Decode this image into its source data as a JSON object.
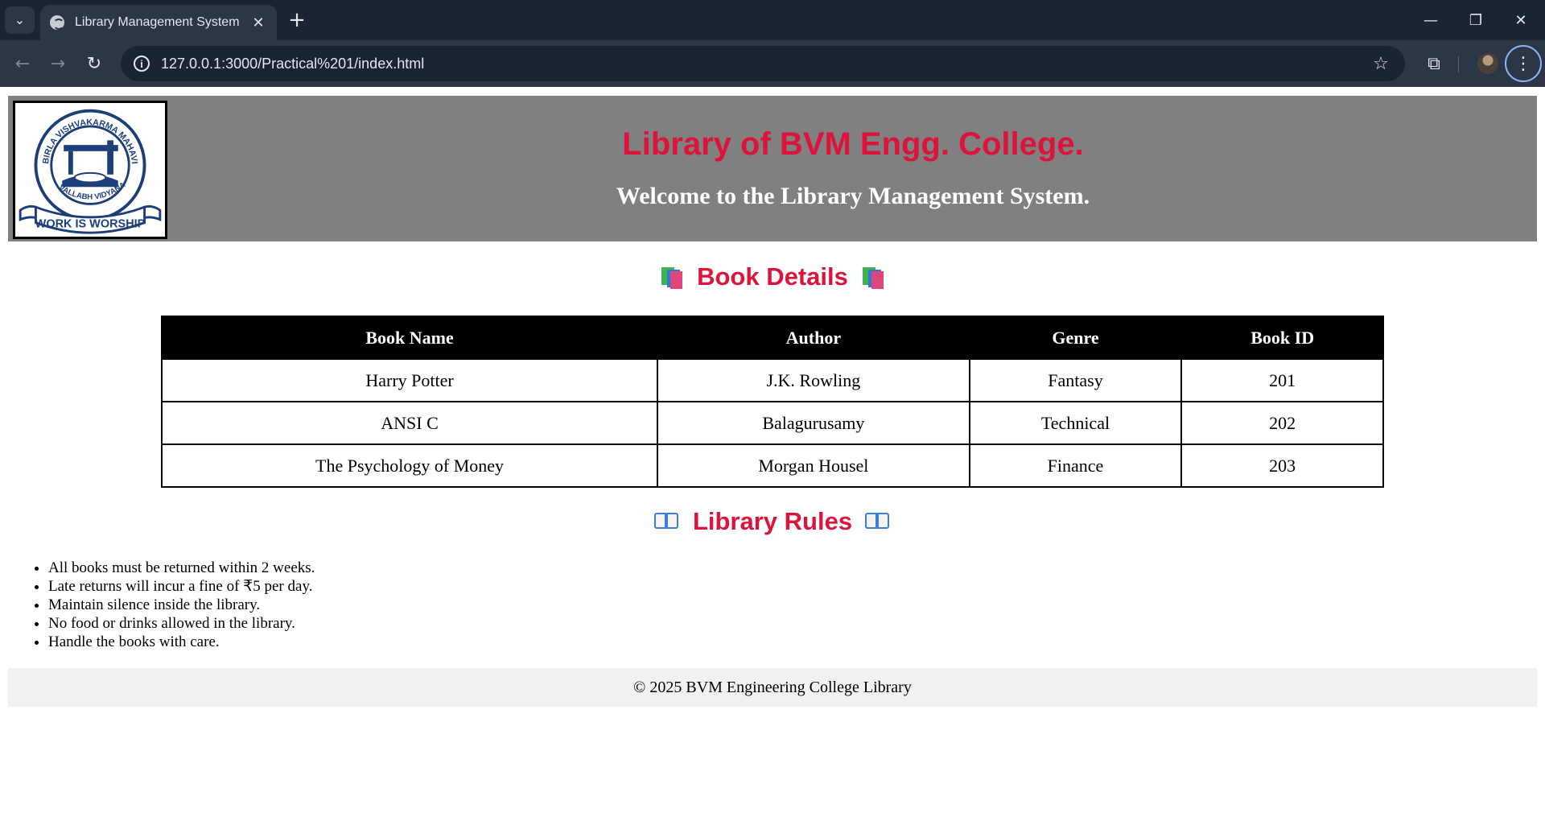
{
  "browser": {
    "tab_title": "Library Management System",
    "url": "127.0.0.1:3000/Practical%201/index.html",
    "icons": {
      "tab_search": "chevron-down-icon",
      "new_tab": "plus-icon",
      "minimize": "minimize-icon",
      "restore": "restore-icon",
      "close": "close-icon",
      "back": "back-arrow-icon",
      "forward": "forward-arrow-icon",
      "reload": "reload-icon",
      "site_info": "info-icon",
      "bookmark": "star-icon",
      "extensions": "puzzle-icon",
      "menu": "kebab-menu-icon"
    }
  },
  "header": {
    "title": "Library of BVM Engg. College.",
    "subtitle": "Welcome to the Library Management System.",
    "logo": {
      "ring_text": "BIRLA VISHVAKARMA MAHAVIDYALAYA",
      "bottom_text": "VALLABH VIDYANAGAR",
      "motto": "WORK IS WORSHIP"
    },
    "background": "#808080",
    "title_color": "#dc143c"
  },
  "book_section": {
    "title": "Book Details",
    "emoji": "books-emoji",
    "columns": [
      "Book Name",
      "Author",
      "Genre",
      "Book ID"
    ],
    "rows": [
      [
        "Harry Potter",
        "J.K. Rowling",
        "Fantasy",
        "201"
      ],
      [
        "ANSI C",
        "Balagurusamy",
        "Technical",
        "202"
      ],
      [
        "The Psychology of Money",
        "Morgan Housel",
        "Finance",
        "203"
      ]
    ]
  },
  "rules_section": {
    "title": "Library Rules",
    "emoji": "open-book-emoji",
    "items": [
      "All books must be returned within 2 weeks.",
      "Late returns will incur a fine of ₹5 per day.",
      "Maintain silence inside the library.",
      "No food or drinks allowed in the library.",
      "Handle the books with care."
    ]
  },
  "footer": {
    "text": "© 2025 BVM Engineering College Library"
  },
  "colors": {
    "accent": "#dc143c",
    "table_header_bg": "#000000",
    "footer_bg": "#f1f1f1"
  }
}
